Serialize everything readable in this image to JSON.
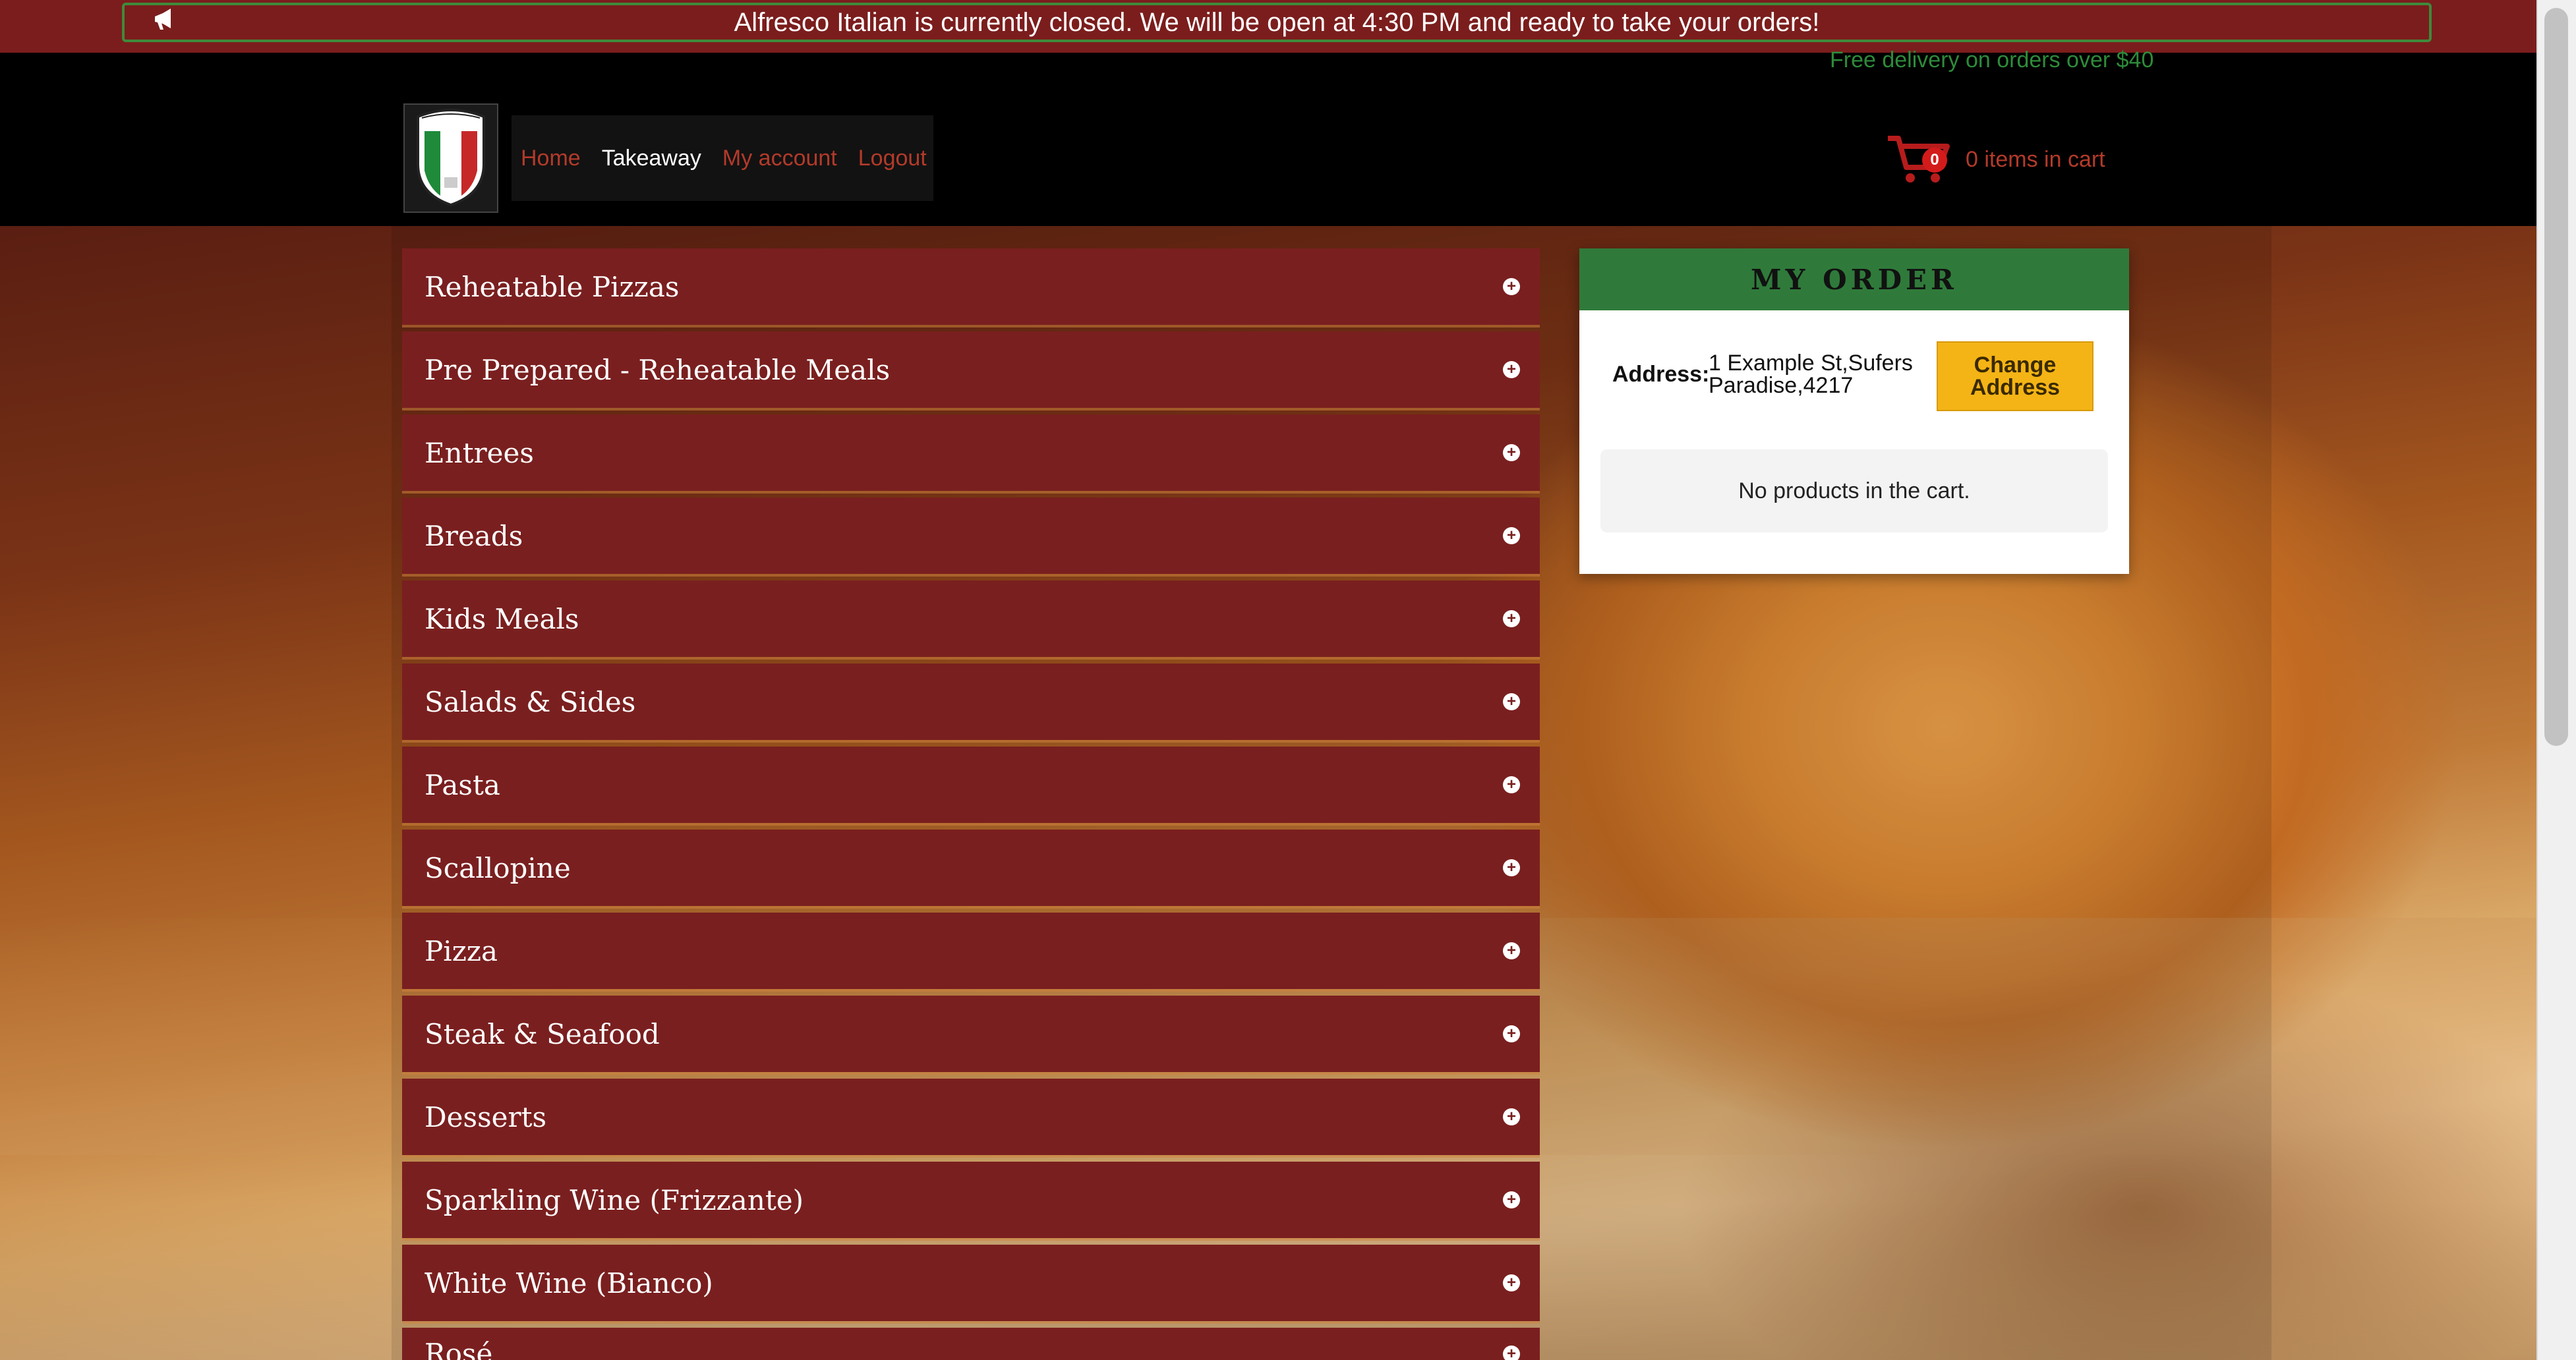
{
  "notice": {
    "text": "Alfresco Italian is currently closed. We will be open at 4:30 PM and ready to take your orders!",
    "icon": "megaphone-icon"
  },
  "header": {
    "free_delivery": "Free delivery on orders over $40",
    "logo_icon": "alfresco-shield-logo",
    "nav": [
      {
        "label": "Home"
      },
      {
        "label": "Takeaway"
      },
      {
        "label": "My account"
      },
      {
        "label": "Logout"
      }
    ],
    "cart": {
      "icon": "shopping-cart-icon",
      "count": "0",
      "text": "0 items in cart"
    }
  },
  "categories": [
    {
      "name": "Reheatable Pizzas"
    },
    {
      "name": "Pre Prepared - Reheatable Meals"
    },
    {
      "name": "Entrees"
    },
    {
      "name": "Breads"
    },
    {
      "name": "Kids Meals"
    },
    {
      "name": "Salads & Sides"
    },
    {
      "name": "Pasta"
    },
    {
      "name": "Scallopine"
    },
    {
      "name": "Pizza"
    },
    {
      "name": "Steak & Seafood"
    },
    {
      "name": "Desserts"
    },
    {
      "name": "Sparkling Wine (Frizzante)"
    },
    {
      "name": "White Wine (Bianco)"
    },
    {
      "name": "Rosé"
    }
  ],
  "order": {
    "title": "MY ORDER",
    "address_label": "Address:",
    "address_value": "1 Example St,Sufers Paradise,4217",
    "change_address": "Change Address",
    "empty_message": "No products in the cart."
  },
  "colors": {
    "notice_bg": "#7b1d1d",
    "notice_border": "#3f8a3b",
    "category_bg": "#7a1f1f",
    "order_header": "#2f7a3a",
    "button": "#f4b416",
    "nav_link": "#b33a2a",
    "free_delivery": "#2e8b3a"
  }
}
